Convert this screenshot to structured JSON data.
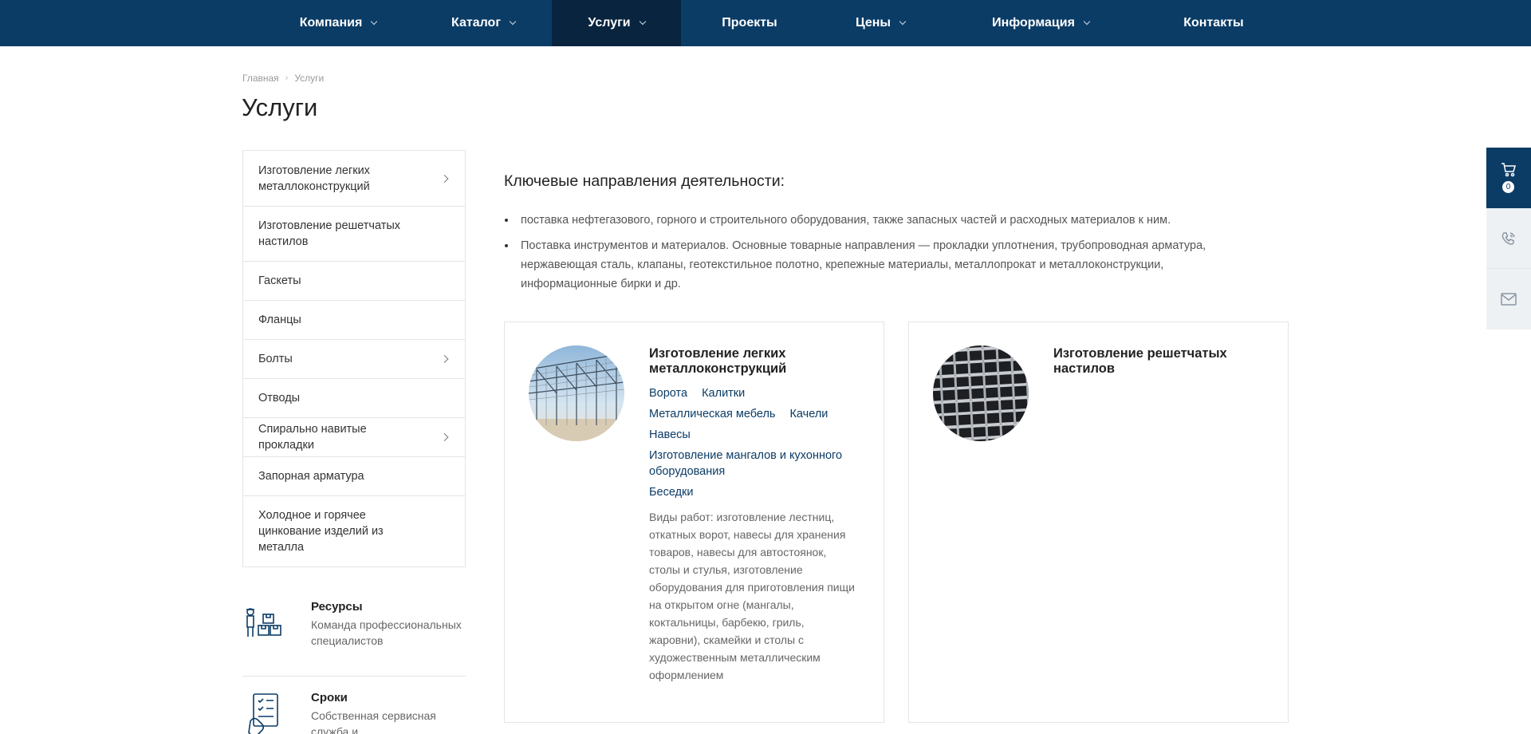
{
  "nav": {
    "items": [
      {
        "label": "Компания",
        "has_dropdown": true
      },
      {
        "label": "Каталог",
        "has_dropdown": true
      },
      {
        "label": "Услуги",
        "has_dropdown": true,
        "active": true
      },
      {
        "label": "Проекты",
        "has_dropdown": false
      },
      {
        "label": "Цены",
        "has_dropdown": true
      },
      {
        "label": "Информация",
        "has_dropdown": true
      },
      {
        "label": "Контакты",
        "has_dropdown": false
      }
    ]
  },
  "breadcrumb": {
    "home": "Главная",
    "current": "Услуги"
  },
  "page_title": "Услуги",
  "sidebar": {
    "items": [
      {
        "label": "Изготовление легких металлоконструкций",
        "has_children": true
      },
      {
        "label": "Изготовление решетчатых настилов",
        "has_children": false
      },
      {
        "label": "Гаскеты",
        "has_children": false
      },
      {
        "label": "Фланцы",
        "has_children": false
      },
      {
        "label": "Болты",
        "has_children": true
      },
      {
        "label": "Отводы",
        "has_children": false
      },
      {
        "label": "Спирально навитые прокладки",
        "has_children": true
      },
      {
        "label": "Запорная арматура",
        "has_children": false
      },
      {
        "label": "Холодное и горячее цинкование изделий из металла",
        "has_children": false
      }
    ]
  },
  "features": [
    {
      "icon": "worker-boxes-icon",
      "title": "Ресурсы",
      "text": "Команда профессиональных специалистов"
    },
    {
      "icon": "checklist-hand-icon",
      "title": "Сроки",
      "text": "Собственная сервисная служба и"
    }
  ],
  "main": {
    "section_title": "Ключевые направления деятельности:",
    "bullets": [
      "поставка нефтегазового, горного и строительного оборудования, также запасных частей и расходных материалов к ним.",
      "Поставка инструментов и материалов. Основные товарные направления — прокладки уплотнения, трубопроводная арматура, нержавеющая сталь, клапаны, геотекстильное полотно, крепежные материалы, металлопрокат и металлоконструкции, информационные бирки и др."
    ],
    "cards": [
      {
        "title": "Изготовление легких металлоконструкций",
        "image": "steel-frame-structure-photo",
        "links": [
          "Ворота",
          "Калитки",
          "Металлическая мебель",
          "Качели",
          "Навесы",
          "Изготовление мангалов и кухонного оборудования",
          "Беседки"
        ],
        "description": "Виды работ: изготовление лестниц, откатных ворот, навесы для хранения товаров, навесы для автостоянок, столы и стулья, изготовление оборудования для приготовления пищи на открытом огне (мангалы, коктальницы, барбекю, гриль, жаровни), скамейки и столы с художественным металлическим оформлением"
      },
      {
        "title": "Изготовление решетчатых настилов",
        "image": "metal-grating-photo",
        "links": [],
        "description": ""
      }
    ]
  },
  "float_panel": {
    "cart_count": "0",
    "buttons": [
      "cart-icon",
      "phone-icon",
      "mail-icon"
    ]
  },
  "colors": {
    "brand": "#0b3c66",
    "nav_active": "#08243f",
    "link": "#0b3c66"
  }
}
